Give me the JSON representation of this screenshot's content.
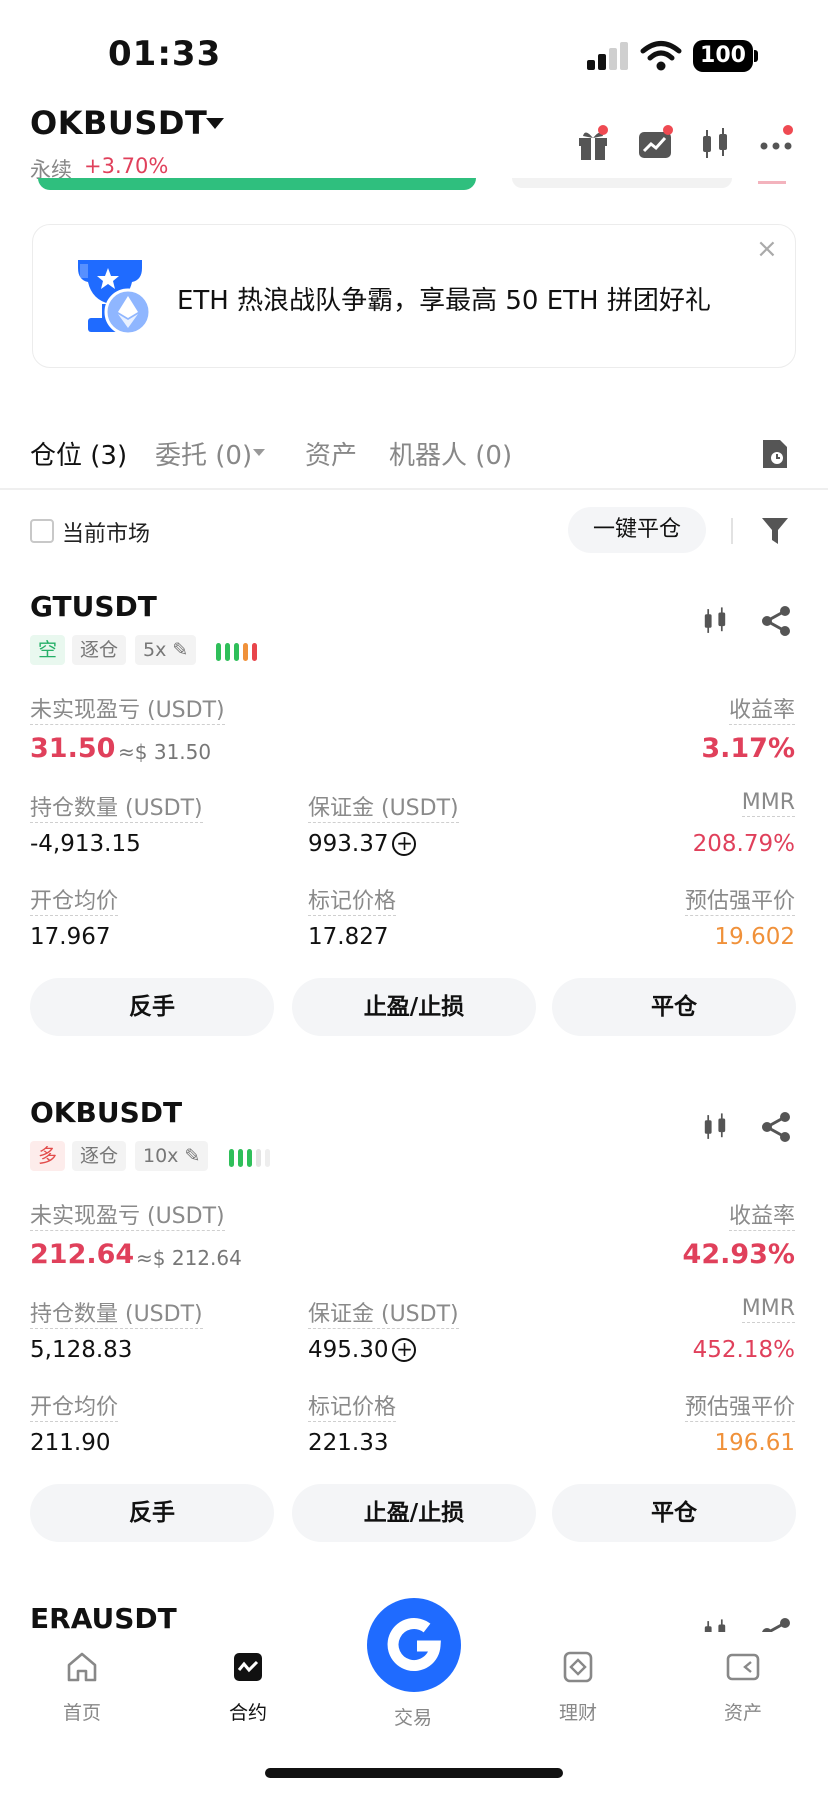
{
  "status_bar": {
    "time": "01:33",
    "battery": "100"
  },
  "header": {
    "pair": "OKBUSDT",
    "type_label": "永续",
    "change": "+3.70%"
  },
  "banner": {
    "text": "ETH 热浪战队争霸，享最高 50 ETH 拼团好礼",
    "close": "×"
  },
  "tabs": [
    {
      "label": "仓位 (3)"
    },
    {
      "label": "委托 (0)"
    },
    {
      "label": "资产"
    },
    {
      "label": "机器人 (0)"
    }
  ],
  "filter": {
    "checkbox_label": "当前市场",
    "close_all": "一键平仓"
  },
  "labels": {
    "unrealized": "未实现盈亏 (USDT)",
    "roe": "收益率",
    "size": "持仓数量 (USDT)",
    "margin": "保证金 (USDT)",
    "mmr": "MMR",
    "entry": "开仓均价",
    "mark": "标记价格",
    "liq": "预估强平价",
    "btn_reverse": "反手",
    "btn_tpsl": "止盈/止损",
    "btn_close": "平仓"
  },
  "positions": [
    {
      "symbol": "GTUSDT",
      "side": "空",
      "mode": "逐仓",
      "leverage": "5x",
      "risk_colors": [
        "#2fbf5a",
        "#2fbf5a",
        "#2fbf5a",
        "#f0913a",
        "#e8454b"
      ],
      "pnl": "31.50",
      "pnl_usd": "≈$ 31.50",
      "roe": "3.17%",
      "size": "-4,913.15",
      "margin": "993.37",
      "mmr": "208.79%",
      "entry": "17.967",
      "mark": "17.827",
      "liq": "19.602"
    },
    {
      "symbol": "OKBUSDT",
      "side": "多",
      "mode": "逐仓",
      "leverage": "10x",
      "risk_colors": [
        "#2fbf5a",
        "#2fbf5a",
        "#2fbf5a",
        "#e4e4e4",
        "#eeeeee"
      ],
      "pnl": "212.64",
      "pnl_usd": "≈$ 212.64",
      "roe": "42.93%",
      "size": "5,128.83",
      "margin": "495.30",
      "mmr": "452.18%",
      "entry": "211.90",
      "mark": "221.33",
      "liq": "196.61"
    },
    {
      "symbol": "ERAUSDT"
    }
  ],
  "nav": [
    {
      "label": "首页",
      "icon": "home-icon"
    },
    {
      "label": "合约",
      "icon": "futures-icon"
    },
    {
      "label": "交易",
      "icon": "trade-icon"
    },
    {
      "label": "理财",
      "icon": "earn-icon"
    },
    {
      "label": "资产",
      "icon": "assets-icon"
    }
  ],
  "colors": {
    "accent_blue": "#1f6bff",
    "up_red": "#e0405b",
    "liq_orange": "#f0913a",
    "green": "#2fbf7e"
  }
}
